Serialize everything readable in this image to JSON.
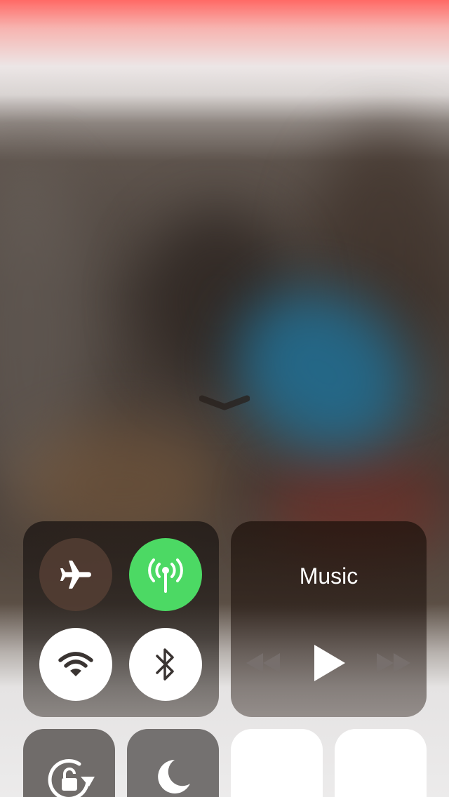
{
  "control_center": {
    "dismiss_icon": "chevron-down-icon",
    "connectivity": {
      "airplane_mode": {
        "icon": "airplane-icon",
        "state": "off"
      },
      "cellular_data": {
        "icon": "antenna-icon",
        "state": "on",
        "color": "#4cd964"
      },
      "wifi": {
        "icon": "wifi-icon",
        "state": "on"
      },
      "bluetooth": {
        "icon": "bluetooth-icon",
        "state": "on"
      }
    },
    "music": {
      "title": "Music",
      "controls": [
        "rewind-icon",
        "play-icon",
        "fast-forward-icon"
      ]
    },
    "tiles": [
      {
        "icon": "rotation-lock-icon"
      },
      {
        "icon": "moon-icon"
      },
      {
        "icon": ""
      },
      {
        "icon": ""
      }
    ]
  }
}
